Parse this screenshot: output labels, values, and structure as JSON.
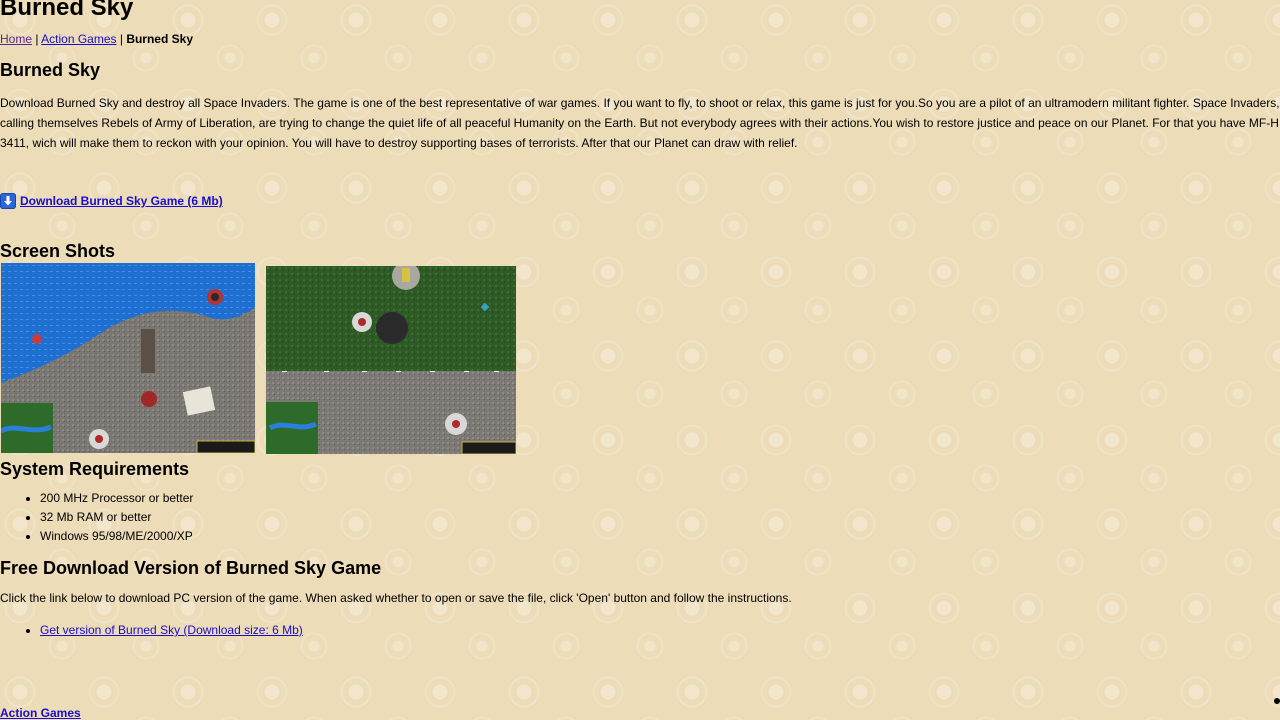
{
  "page": {
    "title": "Burned Sky",
    "breadcrumb": {
      "home": "Home",
      "sep1": " | ",
      "category": "Action Games",
      "sep2": " | ",
      "current": "Burned Sky"
    },
    "game_title": "Burned Sky",
    "description": "Download Burned Sky and destroy all Space Invaders. The game is one of the best representative of war games. If you want to fly, to shoot or relax, this game is just for you.So you are a pilot of an ultramodern militant fighter. Space Invaders, calling themselves Rebels of Army of Liberation, are trying to change the quiet life of all peaceful Humanity on the Earth. But not everybody agrees with their actions.You wish to restore justice and peace on our Planet. For that you have MF-H 3411, wich will make them to reckon with your opinion. You will have to destroy supporting bases of terrorists. After that our Planet can draw with relief.",
    "download_link": "Download Burned Sky Game (6 Mb)",
    "screenshots_heading": "Screen Shots",
    "requirements_heading": "System Requirements",
    "requirements": [
      "200 MHz Processor or better",
      "32 Mb RAM or better",
      "Windows 95/98/ME/2000/XP"
    ],
    "free_heading": "Free Download Version of Burned Sky Game",
    "free_text": "Click the link below to download PC version of the game. When asked whether to open or save the file, click 'Open' button and follow the instructions.",
    "get_link": "Get version of Burned Sky (Download size: 6 Mb)",
    "bottom_link": "Action Games"
  },
  "colors": {
    "background": "#ecdcb8",
    "link": "#1a0dcc",
    "visited_link": "#5a2a8a"
  },
  "icons": {
    "download": "download-arrow-icon"
  }
}
